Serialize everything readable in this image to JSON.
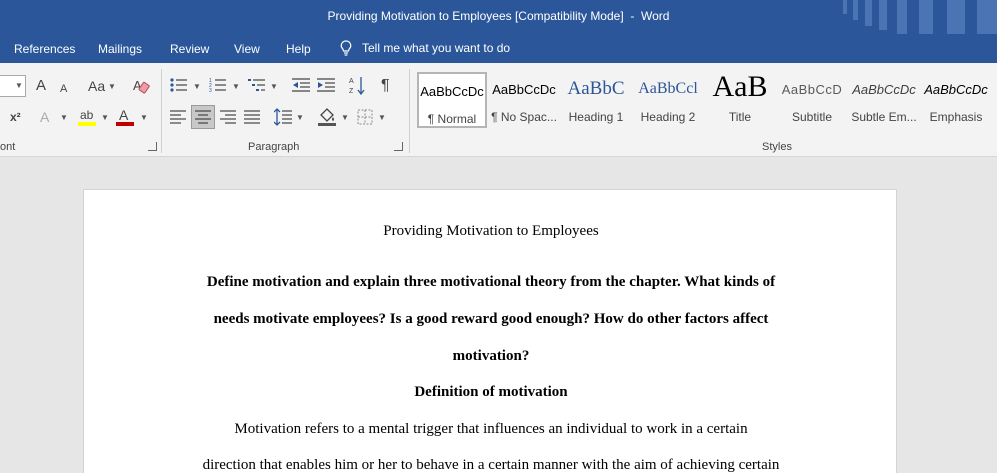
{
  "window": {
    "doc_title": "Providing Motivation to Employees [Compatibility Mode]",
    "separator": "  -  ",
    "app_name": "Word"
  },
  "menu": {
    "items": [
      "References",
      "Mailings",
      "Review",
      "View",
      "Help"
    ],
    "tell_me": "Tell me what you want to do"
  },
  "ribbon": {
    "groups": {
      "font": "ont",
      "paragraph": "Paragraph",
      "styles": "Styles"
    },
    "font_buttons": {
      "grow": "A",
      "shrink": "A",
      "change_case": "Aa",
      "superscript": "x²",
      "text_effects": "A",
      "highlight": "ab",
      "font_color": "A"
    },
    "paragraph_buttons": {
      "show_marks": "¶"
    },
    "styles": [
      {
        "sample": "AaBbCcDc",
        "name": "¶ Normal"
      },
      {
        "sample": "AaBbCcDc",
        "name": "¶ No Spac..."
      },
      {
        "sample": "AaBbC",
        "name": "Heading 1"
      },
      {
        "sample": "AaBbCcl",
        "name": "Heading 2"
      },
      {
        "sample": "AaB",
        "name": "Title"
      },
      {
        "sample": "AaBbCcD",
        "name": "Subtitle"
      },
      {
        "sample": "AaBbCcDc",
        "name": "Subtle Em..."
      },
      {
        "sample": "AaBbCcDc",
        "name": "Emphasis"
      }
    ],
    "colors": {
      "highlight": "#ffff00",
      "font_color": "#c00000",
      "brand": "#2b579a"
    }
  },
  "document": {
    "title": "Providing Motivation to Employees",
    "question_lines": [
      "Define motivation and explain three motivational theory from the chapter. What kinds of",
      "needs motivate employees? Is a good reward good enough? How do other factors affect",
      "motivation?"
    ],
    "heading": "Definition of motivation",
    "body_lines": [
      "Motivation refers to a mental trigger that influences an individual to work in a certain",
      "direction that enables him or her to behave in a certain manner with the aim of achieving certain"
    ]
  }
}
